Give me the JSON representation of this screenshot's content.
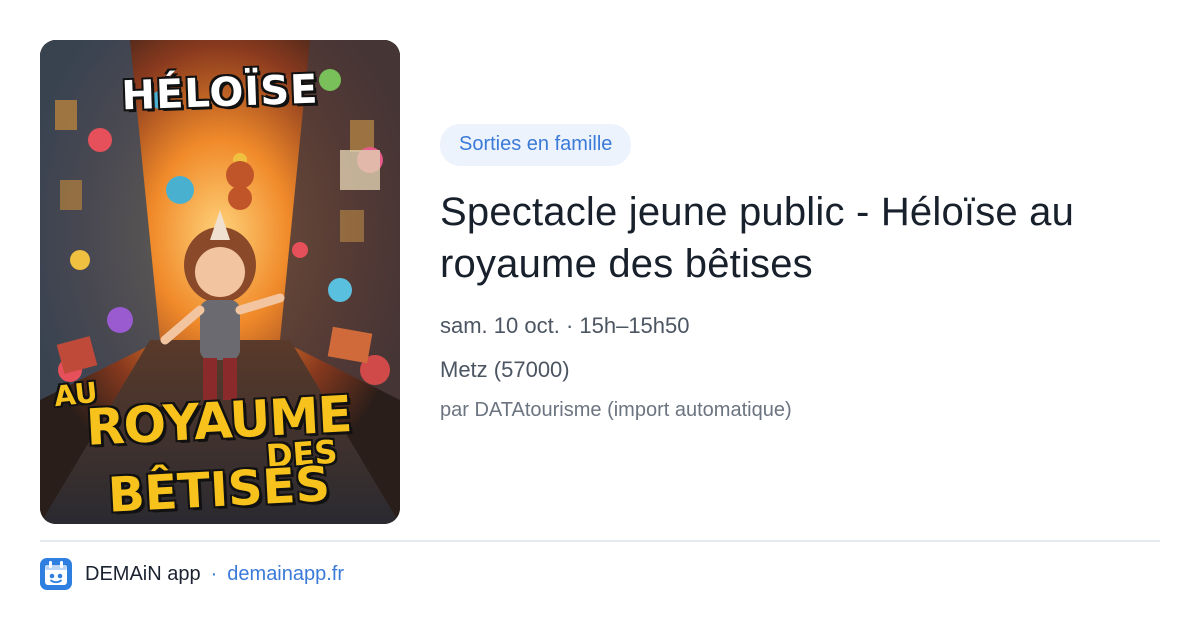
{
  "poster": {
    "title_top": "HÉLOÏSE",
    "title_au": "AU",
    "title_royaume": "ROYAUME",
    "title_des": "DES",
    "title_betises": "BÊTISES"
  },
  "event": {
    "tag": "Sorties en famille",
    "title": "Spectacle jeune public - Héloïse au royaume des bêtises",
    "datetime": "sam. 10 oct. · 15h–15h50",
    "location": "Metz (57000)",
    "source": "par DATAtourisme (import automatique)"
  },
  "footer": {
    "icon": "demain-app-icon",
    "app_name": "DEMAiN app",
    "separator": "·",
    "link": "demainapp.fr"
  },
  "colors": {
    "accent": "#3a7ad8",
    "tag_bg": "#edf3fd",
    "poster_text": "#f7c21c"
  }
}
